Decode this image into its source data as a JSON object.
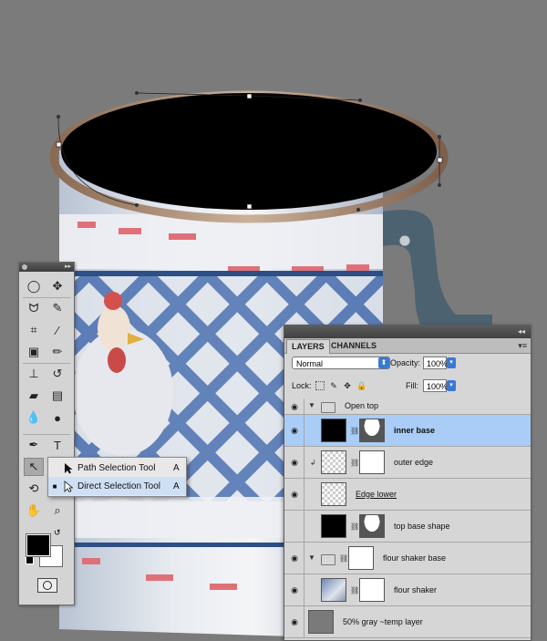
{
  "tools_palette": {
    "title_menu": "▸▸",
    "tools": [
      {
        "name": "elliptical-marquee-tool-icon",
        "glyph": "◯"
      },
      {
        "name": "move-tool-icon",
        "glyph": "✥"
      },
      {
        "name": "lasso-tool-icon",
        "glyph": "ᗢ"
      },
      {
        "name": "quick-selection-tool-icon",
        "glyph": "✎"
      },
      {
        "name": "crop-tool-icon",
        "glyph": "⌗"
      },
      {
        "name": "eyedropper-tool-icon",
        "glyph": "⁄"
      },
      {
        "name": "healing-brush-tool-icon",
        "glyph": "▣"
      },
      {
        "name": "brush-tool-icon",
        "glyph": "✏"
      },
      {
        "name": "clone-stamp-tool-icon",
        "glyph": "⊥"
      },
      {
        "name": "history-brush-tool-icon",
        "glyph": "↺"
      },
      {
        "name": "eraser-tool-icon",
        "glyph": "▰"
      },
      {
        "name": "gradient-tool-icon",
        "glyph": "▤"
      },
      {
        "name": "blur-tool-icon",
        "glyph": "💧"
      },
      {
        "name": "dodge-tool-icon",
        "glyph": "●"
      },
      {
        "name": "pen-tool-icon",
        "glyph": "✒"
      },
      {
        "name": "type-tool-icon",
        "glyph": "T"
      },
      {
        "name": "direct-selection-tool-icon",
        "glyph": "↖"
      },
      {
        "name": "shape-tool-icon",
        "glyph": "▭"
      },
      {
        "name": "3d-rotate-tool-icon",
        "glyph": "⟲"
      },
      {
        "name": "3d-orbit-tool-icon",
        "glyph": "◎"
      },
      {
        "name": "hand-tool-icon",
        "glyph": "✋"
      },
      {
        "name": "zoom-tool-icon",
        "glyph": "⌕"
      }
    ],
    "foreground_color": "#000000",
    "background_color": "#ffffff"
  },
  "flyout": {
    "items": [
      {
        "label": "Path Selection Tool",
        "shortcut": "A",
        "bullet": ""
      },
      {
        "label": "Direct Selection Tool",
        "shortcut": "A",
        "bullet": "■"
      }
    ]
  },
  "layers_panel": {
    "tabs": [
      "LAYERS",
      "CHANNELS"
    ],
    "blend_mode": "Normal",
    "opacity_label": "Opacity:",
    "opacity_value": "100%",
    "lock_label": "Lock:",
    "fill_label": "Fill:",
    "fill_value": "100%",
    "layers": [
      {
        "name": "Open top",
        "kind": "group",
        "visible": true
      },
      {
        "name": "inner base",
        "kind": "layer",
        "visible": true,
        "selected": true
      },
      {
        "name": "outer edge",
        "kind": "layer",
        "visible": true
      },
      {
        "name": "Edge lower",
        "kind": "layer",
        "visible": true
      },
      {
        "name": "top base shape",
        "kind": "layer",
        "visible": false
      },
      {
        "name": "flour shaker base",
        "kind": "group",
        "visible": true
      },
      {
        "name": "flour shaker",
        "kind": "layer",
        "visible": true
      },
      {
        "name": "50% gray ~temp layer",
        "kind": "layer",
        "visible": true
      }
    ]
  },
  "colors": {
    "canvas_background": "#7b7b7b",
    "selected_layer": "#a9cdf6",
    "selected_menu": "#cfe0f5"
  }
}
